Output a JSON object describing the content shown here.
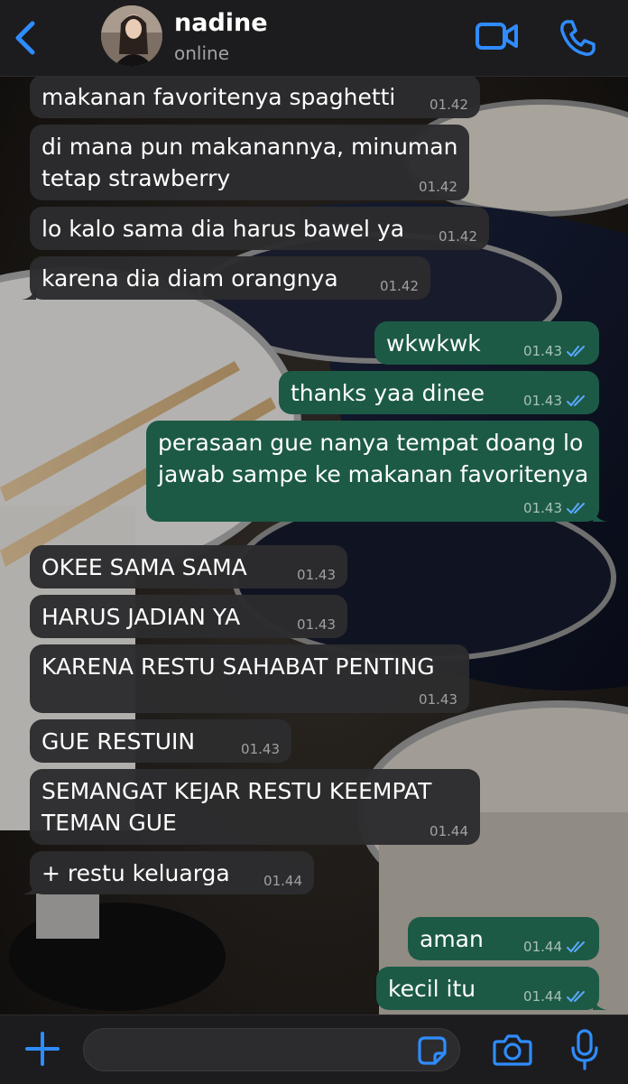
{
  "header": {
    "contact_name": "nadine",
    "status": "online",
    "icons": [
      "chevron-left-icon",
      "avatar",
      "video-camera-icon",
      "phone-icon"
    ]
  },
  "colors": {
    "accent": "#2f8cff",
    "incoming_bubble": "#2c2c2e",
    "outgoing_bubble": "#1c5a46",
    "read_ticks": "#5aa9ff"
  },
  "messages": [
    {
      "dir": "in",
      "text": "makanan favoritenya spaghetti",
      "time": "01.42"
    },
    {
      "dir": "in",
      "text": "di mana pun makanannya, minuman\ntetap strawberry",
      "time": "01.42"
    },
    {
      "dir": "in",
      "text": "lo kalo sama dia harus bawel ya",
      "time": "01.42"
    },
    {
      "dir": "in",
      "text": "karena dia diam orangnya",
      "time": "01.42"
    },
    {
      "dir": "out",
      "text": "wkwkwk",
      "time": "01.43",
      "read": true
    },
    {
      "dir": "out",
      "text": "thanks yaa dinee",
      "time": "01.43",
      "read": true
    },
    {
      "dir": "out",
      "text": "perasaan gue nanya tempat doang lo\njawab sampe ke makanan favoritenya",
      "time": "01.43",
      "read": true
    },
    {
      "dir": "in",
      "text": "OKEE SAMA SAMA",
      "time": "01.43"
    },
    {
      "dir": "in",
      "text": "HARUS JADIAN YA",
      "time": "01.43"
    },
    {
      "dir": "in",
      "text": "KARENA RESTU SAHABAT PENTING",
      "time": "01.43"
    },
    {
      "dir": "in",
      "text": "GUE RESTUIN",
      "time": "01.43"
    },
    {
      "dir": "in",
      "text": "SEMANGAT KEJAR RESTU KEEMPAT\nTEMAN GUE",
      "time": "01.44"
    },
    {
      "dir": "in",
      "text": "+ restu keluarga",
      "time": "01.44"
    },
    {
      "dir": "out",
      "text": "aman",
      "time": "01.44",
      "read": true
    },
    {
      "dir": "out",
      "text": "kecil itu",
      "time": "01.44",
      "read": true
    }
  ],
  "input": {
    "placeholder": "",
    "value": "",
    "icons": [
      "plus-icon",
      "sticker-icon",
      "camera-icon",
      "microphone-icon"
    ]
  }
}
